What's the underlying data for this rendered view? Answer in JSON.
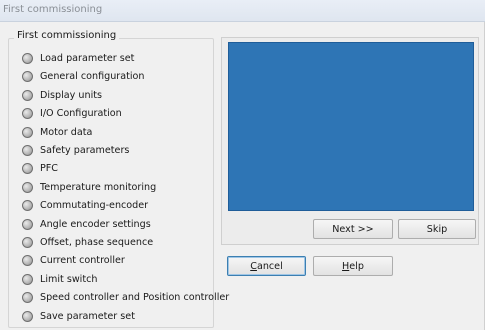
{
  "window": {
    "title": "First commissioning"
  },
  "steps": {
    "legend": "First commissioning",
    "items": [
      {
        "label": "Load parameter set"
      },
      {
        "label": "General configuration"
      },
      {
        "label": "Display units"
      },
      {
        "label": "I/O Configuration"
      },
      {
        "label": "Motor data"
      },
      {
        "label": "Safety parameters"
      },
      {
        "label": "PFC"
      },
      {
        "label": "Temperature monitoring"
      },
      {
        "label": "Commutating-encoder"
      },
      {
        "label": "Angle encoder settings"
      },
      {
        "label": "Offset, phase sequence"
      },
      {
        "label": "Current controller"
      },
      {
        "label": "Limit switch"
      },
      {
        "label": "Speed controller and Position controller"
      },
      {
        "label": "Save parameter set"
      }
    ]
  },
  "navigation": {
    "next": "Next >>",
    "skip": "Skip"
  },
  "actions": {
    "cancel_first": "C",
    "cancel_rest": "ancel",
    "help_first": "H",
    "help_rest": "elp"
  },
  "colors": {
    "preview": "#2e75b5"
  }
}
